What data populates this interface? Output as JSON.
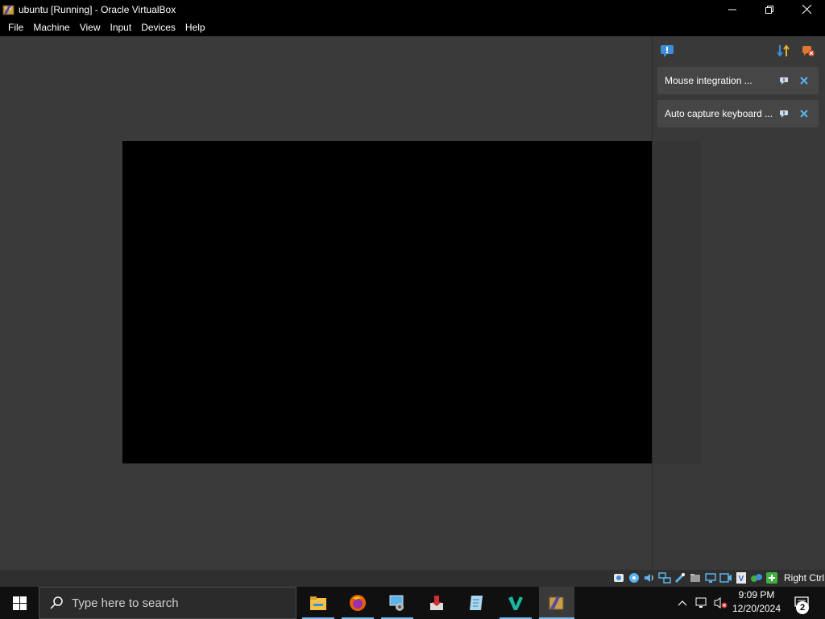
{
  "window": {
    "title": "ubuntu [Running] - Oracle VirtualBox",
    "icon": "virtualbox-icon",
    "controls": [
      "minimize-icon",
      "restore-icon",
      "close-icon"
    ]
  },
  "menu": {
    "items": [
      "File",
      "Machine",
      "View",
      "Input",
      "Devices",
      "Help"
    ]
  },
  "notification_center": {
    "toolbar_icons": [
      "notification-center-toggle-icon",
      "sort-order-icon",
      "dismiss-all-icon"
    ],
    "notifications": [
      {
        "label": "Mouse integration ..."
      },
      {
        "label": "Auto capture keyboard ..."
      }
    ]
  },
  "statusbar": {
    "icons": [
      "hard-disk-icon",
      "optical-drive-icon",
      "audio-icon",
      "network-icon",
      "usb-icon",
      "shared-folders-icon",
      "display-icon",
      "recording-icon",
      "vt-x-icon",
      "mouse-integration-icon",
      "keyboard-capture-icon"
    ],
    "host_key": "Right Ctrl"
  },
  "taskbar": {
    "search_placeholder": "Type here to search",
    "apps": [
      "file-explorer-icon",
      "firefox-icon",
      "control-panel-icon",
      "installer-icon",
      "notepad-icon",
      "visual-studio-code-icon",
      "virtualbox-icon"
    ],
    "clock": {
      "time": "9:09 PM",
      "date": "12/20/2024"
    },
    "notification_count": "2"
  },
  "colors": {
    "accent": "#76b9ed",
    "vm_background": "#3a3a3a",
    "guest_screen": "#000000"
  }
}
